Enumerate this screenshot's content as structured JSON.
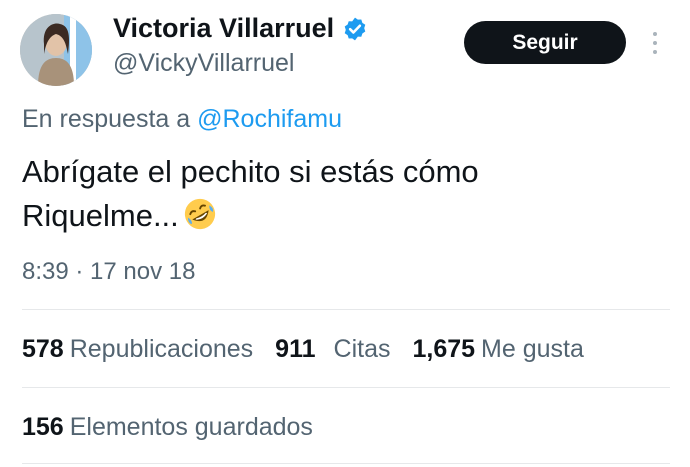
{
  "author": {
    "display_name": "Victoria Villarruel",
    "handle": "@VickyVillarruel",
    "verified": true,
    "verified_color": "#1d9bf0"
  },
  "follow_button": {
    "label": "Seguir"
  },
  "reply": {
    "prefix": "En respuesta a ",
    "mention": "@Rochifamu"
  },
  "tweet": {
    "text_line1": "Abrígate el pechito si estás cómo",
    "text_line2": "Riquelme...",
    "emoji": "rolling-on-the-floor-laughing-icon",
    "timestamp": "8:39 · 17 nov 18"
  },
  "stats": {
    "reposts_count": "578",
    "reposts_label": "Republicaciones",
    "quotes_count": "911",
    "quotes_label": "Citas",
    "likes_count": "1,675",
    "likes_label": "Me gusta",
    "bookmarks_count": "156",
    "bookmarks_label": "Elementos guardados"
  },
  "colors": {
    "accent": "#1d9bf0",
    "text_primary": "#0f1419",
    "text_secondary": "#536471",
    "button_bg": "#0f1419"
  }
}
